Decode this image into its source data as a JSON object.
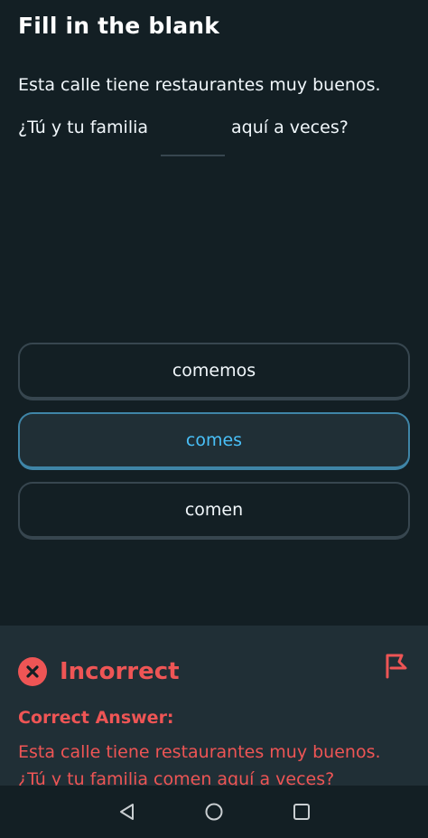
{
  "header": {
    "title": "Fill in the blank"
  },
  "prompt": {
    "sentence": "Esta calle tiene restaurantes muy buenos.",
    "question_before": "¿Tú y tu familia",
    "question_after": "aquí a veces?"
  },
  "options": [
    {
      "label": "comemos",
      "selected": false
    },
    {
      "label": "comes",
      "selected": true
    },
    {
      "label": "comen",
      "selected": false
    }
  ],
  "feedback": {
    "status": "Incorrect",
    "correct_label": "Correct Answer:",
    "correct_text": "Esta calle tiene restaurantes muy buenos. ¿Tú y tu familia comen aquí a veces?"
  },
  "colors": {
    "background": "#131f24",
    "panel": "#202f36",
    "border": "#37464f",
    "selected_border": "#3f85a7",
    "selected_text": "#49c0f8",
    "error": "#ee5555"
  },
  "icons": {
    "status": "x-circle-icon",
    "report": "flag-icon",
    "nav": [
      "back-triangle-icon",
      "home-circle-icon",
      "recents-square-icon"
    ]
  }
}
